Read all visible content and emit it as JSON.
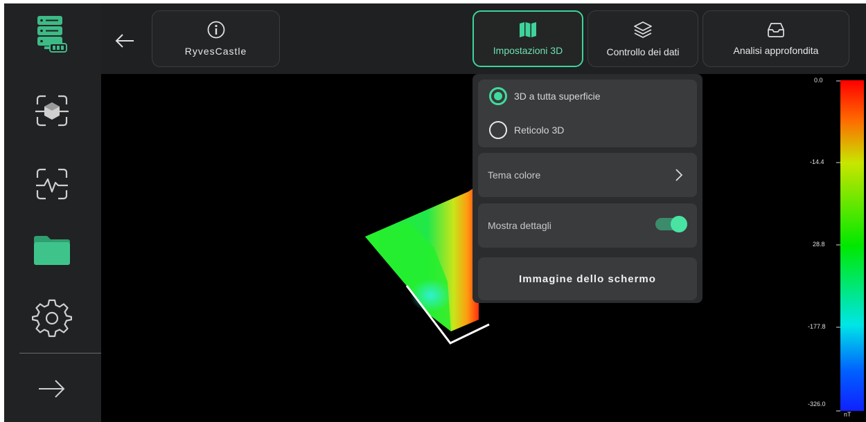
{
  "header": {
    "project_name": "RyvesCastle",
    "tabs": [
      {
        "label": "Impostazioni 3D",
        "icon": "map-icon",
        "active": true
      },
      {
        "label": "Controllo dei dati",
        "icon": "layers-icon",
        "active": false
      },
      {
        "label": "Analisi approfondita",
        "icon": "inbox-icon",
        "active": false
      }
    ]
  },
  "sidebar": {
    "items": [
      {
        "name": "device-icon"
      },
      {
        "name": "scan-3d-icon"
      },
      {
        "name": "scan-pulse-icon"
      },
      {
        "name": "folder-icon"
      },
      {
        "name": "gear-icon"
      },
      {
        "name": "arrow-right-icon"
      }
    ]
  },
  "settings_panel": {
    "render_options": [
      {
        "label": "3D a tutta superficie",
        "selected": true
      },
      {
        "label": "Reticolo 3D",
        "selected": false
      }
    ],
    "color_theme_label": "Tema colore",
    "show_details_label": "Mostra dettagli",
    "show_details_on": true,
    "screenshot_label": "Immagine dello schermo"
  },
  "color_scale": {
    "ticks": [
      "0.0",
      "-14.4",
      "28.8",
      "-177.8",
      "-326.0"
    ],
    "unit": "nT"
  },
  "colors": {
    "accent": "#3ed49b",
    "background": "#1f2022",
    "viewport": "#000000"
  }
}
